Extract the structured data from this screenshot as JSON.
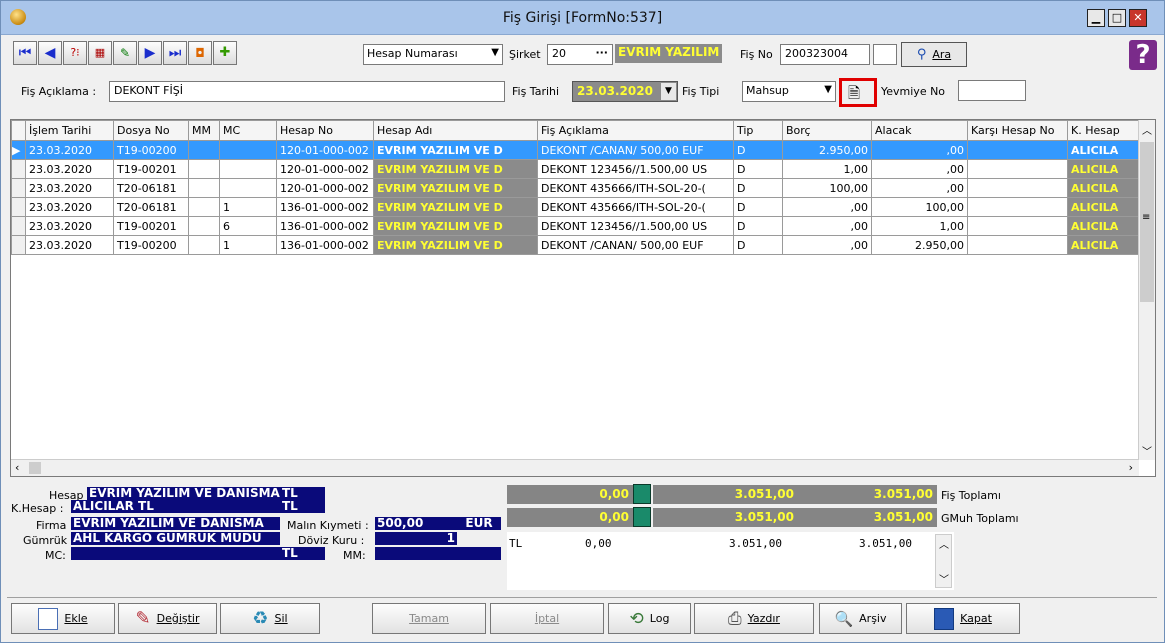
{
  "window": {
    "title": "Fiş Girişi [FormNo:537]",
    "min": "▁",
    "max": "□",
    "close": "✕"
  },
  "toolbar": {
    "search_field": "Hesap Numarası",
    "sirket_label": "Şirket",
    "sirket_value": "20",
    "company_name": "EVRIM YAZILIM",
    "fisno_label": "Fiş No",
    "fisno_value": "200323004",
    "ara_label": "Ara",
    "help": "?"
  },
  "header": {
    "aciklama_label": "Fiş Açıklama :",
    "aciklama_value": "DEKONT FİŞİ",
    "tarih_label": "Fiş Tarihi",
    "tarih_value": "23.03.2020",
    "tip_label": "Fiş Tipi",
    "tip_value": "Mahsup",
    "yevmiye_label": "Yevmiye No",
    "yevmiye_value": ""
  },
  "grid": {
    "columns": [
      "İşlem Tarihi",
      "Dosya No",
      "MM",
      "MC",
      "Hesap No",
      "Hesap Adı",
      "Fiş Açıklama",
      "Tip",
      "Borç",
      "Alacak",
      "Karşı Hesap No",
      "K. Hesap"
    ],
    "rows": [
      [
        "23.03.2020",
        "T19-00200",
        "",
        "",
        "120-01-000-002",
        "EVRIM YAZILIM VE D",
        "DEKONT /CANAN/ 500,00 EUF",
        "D",
        "2.950,00",
        ",00",
        "",
        "ALICILA"
      ],
      [
        "23.03.2020",
        "T19-00201",
        "",
        "",
        "120-01-000-002",
        "EVRIM YAZILIM VE D",
        "DEKONT 123456//1.500,00 US",
        "D",
        "1,00",
        ",00",
        "",
        "ALICILA"
      ],
      [
        "23.03.2020",
        "T20-06181",
        "",
        "",
        "120-01-000-002",
        "EVRIM YAZILIM VE D",
        "DEKONT 435666/ITH-SOL-20-(",
        "D",
        "100,00",
        ",00",
        "",
        "ALICILA"
      ],
      [
        "23.03.2020",
        "T20-06181",
        "",
        "1",
        "136-01-000-002",
        "EVRIM YAZILIM VE D",
        "DEKONT 435666/ITH-SOL-20-(",
        "D",
        ",00",
        "100,00",
        "",
        "ALICILA"
      ],
      [
        "23.03.2020",
        "T19-00201",
        "",
        "6",
        "136-01-000-002",
        "EVRIM YAZILIM VE D",
        "DEKONT 123456//1.500,00 US",
        "D",
        ",00",
        "1,00",
        "",
        "ALICILA"
      ],
      [
        "23.03.2020",
        "T19-00200",
        "",
        "1",
        "136-01-000-002",
        "EVRIM YAZILIM VE D",
        "DEKONT /CANAN/ 500,00 EUF",
        "D",
        ",00",
        "2.950,00",
        "",
        "ALICILA"
      ]
    ]
  },
  "info": {
    "hesap_label": "Hesap :",
    "hesap_value": "EVRIM YAZILIM VE DANISMA",
    "hesap_cur": "TL",
    "khesap_label": "K.Hesap :",
    "khesap_value": "ALICILAR TL",
    "khesap_cur": "TL",
    "firma_label": "Firma :",
    "firma_value": "EVRIM YAZILIM VE DANISMA",
    "malin_label": "Malın Kıymeti :",
    "malin_value": "500,00",
    "malin_cur": "EUR",
    "gumruk_label": "Gümrük :",
    "gumruk_value": "AHL KARGO GÜMRÜK MÜDÜ",
    "doviz_label": "Döviz Kuru :",
    "doviz_value": "1",
    "doviz_cur": "TL",
    "mc_label": "MC:",
    "mm_label": "MM:"
  },
  "totals": {
    "fis_a": "0,00",
    "fis_b": "3.051,00",
    "fis_c": "3.051,00",
    "fis_label": "Fiş Toplamı",
    "gmuh_a": "0,00",
    "gmuh_b": "3.051,00",
    "gmuh_c": "3.051,00",
    "gmuh_label": "GMuh Toplamı",
    "tl_cur": "TL",
    "tl_a": "0,00",
    "tl_b": "3.051,00",
    "tl_c": "3.051,00"
  },
  "buttons": {
    "ekle": "Ekle",
    "degistir": "Değiştir",
    "sil": "Sil",
    "tamam": "Tamam",
    "iptal": "İptal",
    "log": "Log",
    "yazdir": "Yazdır",
    "arsiv": "Arşiv",
    "kapat": "Kapat"
  },
  "colors": {
    "highlight": "#ffff33",
    "selection": "#3399ff",
    "navy": "#0a0a7a",
    "red_box": "#e00000"
  }
}
